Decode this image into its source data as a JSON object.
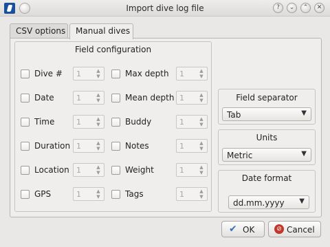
{
  "window": {
    "title": "Import dive log file",
    "controls": [
      "?",
      "⌄",
      "⌃",
      "✕"
    ]
  },
  "tabs": [
    {
      "label": "CSV options",
      "active": false
    },
    {
      "label": "Manual dives",
      "active": true
    }
  ],
  "field_configuration": {
    "title": "Field configuration",
    "left_column": [
      {
        "label": "Dive #",
        "checked": false,
        "value": "1"
      },
      {
        "label": "Date",
        "checked": false,
        "value": "1"
      },
      {
        "label": "Time",
        "checked": false,
        "value": "1"
      },
      {
        "label": "Duration",
        "checked": false,
        "value": "1"
      },
      {
        "label": "Location",
        "checked": false,
        "value": "1"
      },
      {
        "label": "GPS",
        "checked": false,
        "value": "1"
      }
    ],
    "right_column": [
      {
        "label": "Max depth",
        "checked": false,
        "value": "1"
      },
      {
        "label": "Mean depth",
        "checked": false,
        "value": "1"
      },
      {
        "label": "Buddy",
        "checked": false,
        "value": "1"
      },
      {
        "label": "Notes",
        "checked": false,
        "value": "1"
      },
      {
        "label": "Weight",
        "checked": false,
        "value": "1"
      },
      {
        "label": "Tags",
        "checked": false,
        "value": "1"
      }
    ]
  },
  "field_separator": {
    "title": "Field separator",
    "selected": "Tab"
  },
  "units": {
    "title": "Units",
    "selected": "Metric"
  },
  "date_format": {
    "title": "Date format",
    "selected": "dd.mm.yyyy"
  },
  "buttons": {
    "ok": "OK",
    "cancel": "Cancel"
  },
  "colors": {
    "ok_icon": "#3a6fb6",
    "cancel_icon": "#c0392b"
  }
}
